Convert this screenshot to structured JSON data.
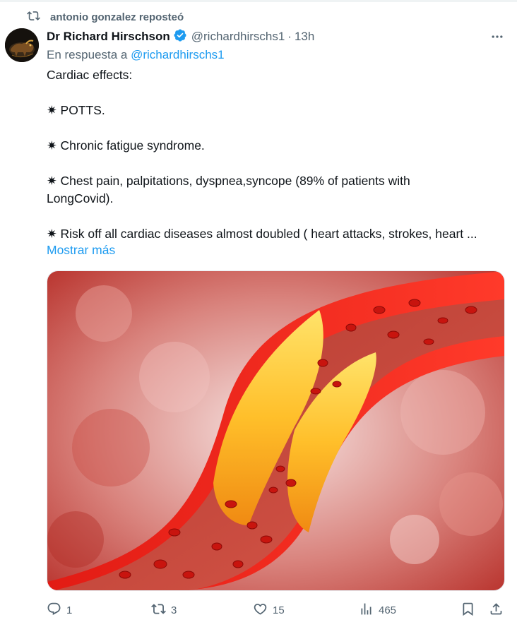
{
  "repost": {
    "text": "antonio gonzalez reposteó",
    "icon": "repost-icon"
  },
  "tweet": {
    "author_name": "Dr Richard Hirschson",
    "handle": "@richardhirschs1",
    "separator": "·",
    "time": "13h",
    "reply_prefix": "En respuesta a",
    "reply_mention": "@richardhirschs1",
    "lines": [
      "Cardiac effects:",
      "",
      "✷ POTTS.",
      "",
      "✷ Chronic fatigue syndrome.",
      "",
      "✷ Chest pain, palpitations, dyspnea,syncope (89% of patients with",
      "LongCovid).",
      "",
      "✷ Risk off all cardiac diseases almost doubled ( heart attacks, strokes, heart ..."
    ],
    "show_more": "Mostrar más",
    "image_subject": "artery with cholesterol plaque and red blood cells"
  },
  "actions": {
    "replies": "1",
    "reposts": "3",
    "likes": "15",
    "views": "465"
  },
  "colors": {
    "accent": "#1d9bf0",
    "muted": "#536471",
    "text": "#0f1419"
  }
}
